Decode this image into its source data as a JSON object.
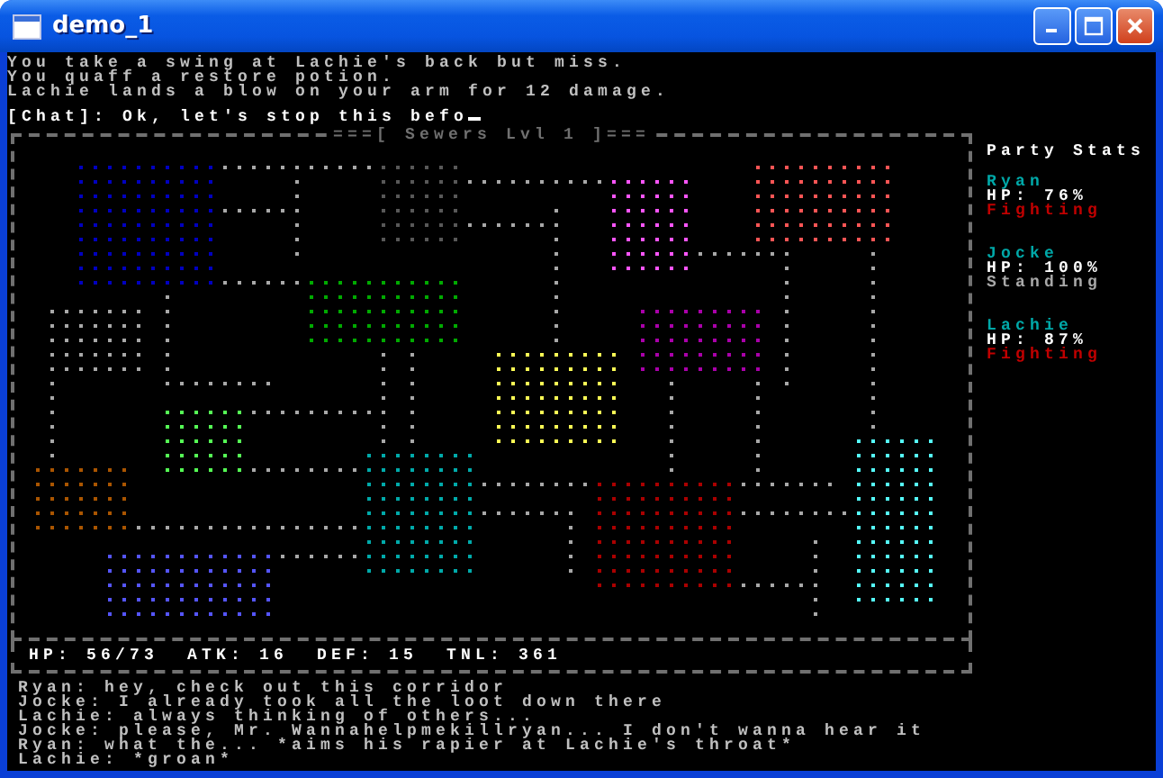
{
  "window": {
    "title": "demo_1"
  },
  "messages": [
    "You take a swing at Lachie's back but miss.",
    "You quaff a restore potion.",
    "Lachie lands a blow on your arm for 12 damage."
  ],
  "chat_input": {
    "label": "[Chat]:",
    "value": "Ok, let's stop this befo"
  },
  "map": {
    "title": "===[ Sewers Lvl 1 ]==="
  },
  "player_stats": [
    {
      "label": "HP:",
      "value": "56/73"
    },
    {
      "label": "ATK:",
      "value": "16"
    },
    {
      "label": "DEF:",
      "value": "15"
    },
    {
      "label": "TNL:",
      "value": "361"
    }
  ],
  "party": {
    "title": "Party Stats",
    "members": [
      {
        "name": "Ryan",
        "hp": "HP: 76%",
        "status": "Fighting",
        "kind": "fighting"
      },
      {
        "name": "Jocke",
        "hp": "HP: 100%",
        "status": "Standing",
        "kind": "standing"
      },
      {
        "name": "Lachie",
        "hp": "HP: 87%",
        "status": "Fighting",
        "kind": "fighting"
      }
    ]
  },
  "chat_log": [
    "Ryan: hey, check out this corridor",
    "Jocke: I already took all the loot down there",
    "Lachie: always thinking of others...",
    "Jocke: please, Mr. Wannahelpmekillryan... I don't wanna hear it",
    "Ryan: what the... *aims his rapier at Lachie's throat*",
    "Lachie: *groan*"
  ]
}
